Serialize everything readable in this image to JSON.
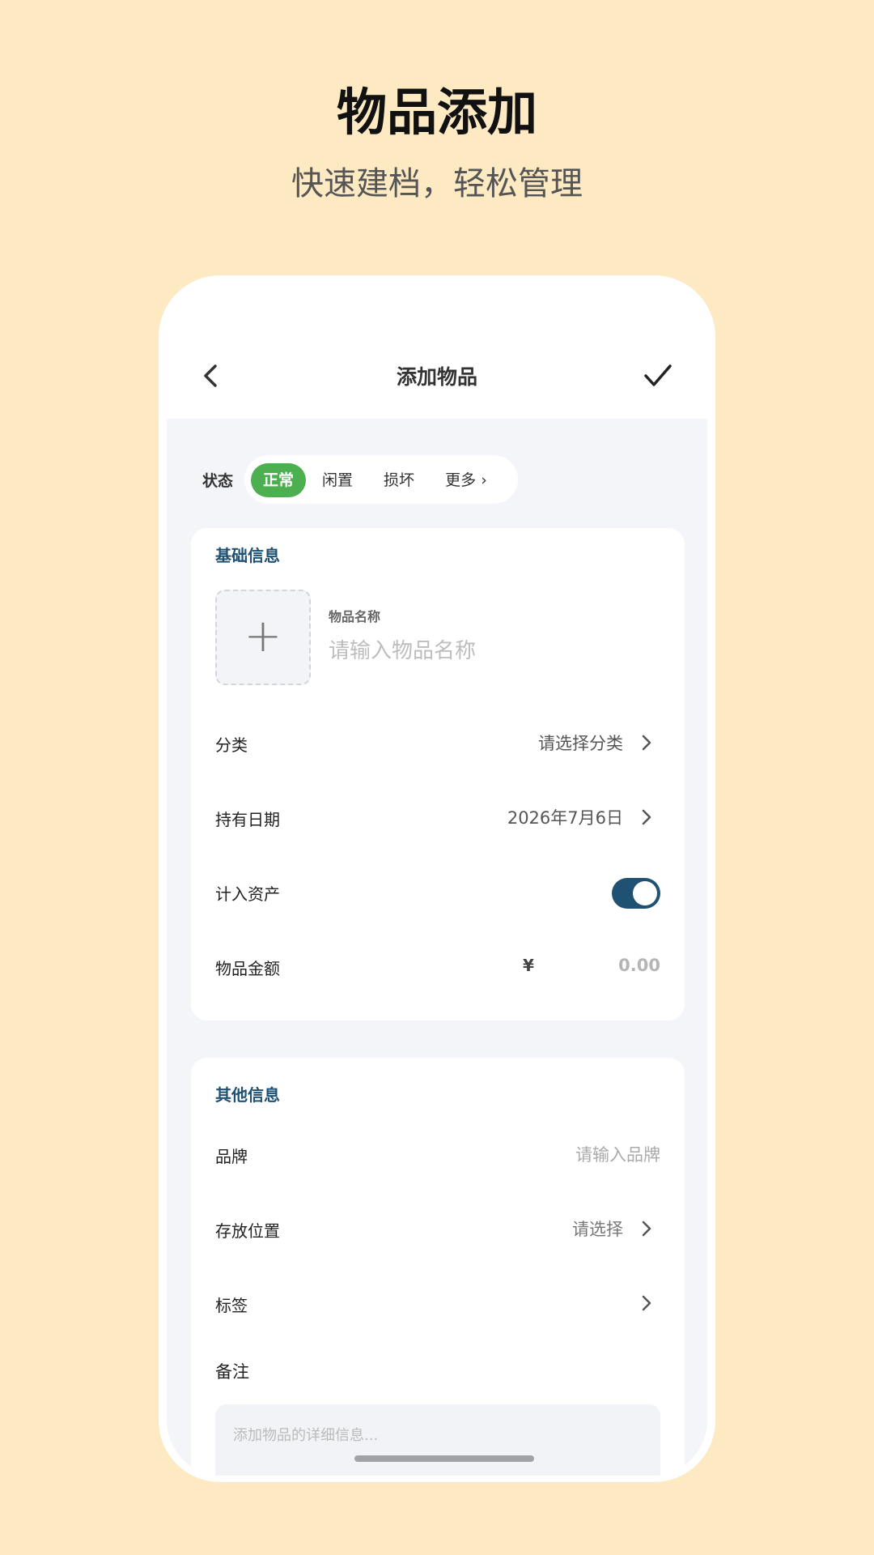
{
  "promo": {
    "title": "物品添加",
    "subtitle": "快速建档，轻松管理"
  },
  "navbar": {
    "title": "添加物品",
    "back_icon": "chevron-left-icon",
    "confirm_icon": "check-icon"
  },
  "status": {
    "label": "状态",
    "options": [
      "正常",
      "闲置",
      "损坏",
      "更多 ›"
    ],
    "selected": "正常",
    "active_color": "#4CAF50"
  },
  "basic_info": {
    "title": "基础信息",
    "photo_add_icon": "plus-icon",
    "name_label": "物品名称",
    "name_placeholder": "请输入物品名称",
    "category_label": "分类",
    "category_value": "请选择分类",
    "date_label": "持有日期",
    "date_value": "2026年7月6日",
    "asset_label": "计入资产",
    "asset_enabled": true,
    "amount_label": "物品金额",
    "currency_symbol": "¥",
    "amount_value": "0.00"
  },
  "other_info": {
    "title": "其他信息",
    "brand_label": "品牌",
    "brand_placeholder": "请输入品牌",
    "location_label": "存放位置",
    "location_value": "请选择",
    "tags_label": "标签",
    "notes_label": "备注",
    "notes_placeholder": "添加物品的详细信息..."
  },
  "colors": {
    "background": "#FDE9C2",
    "accent": "#1F5272",
    "toggle_on": "#1F5272"
  }
}
